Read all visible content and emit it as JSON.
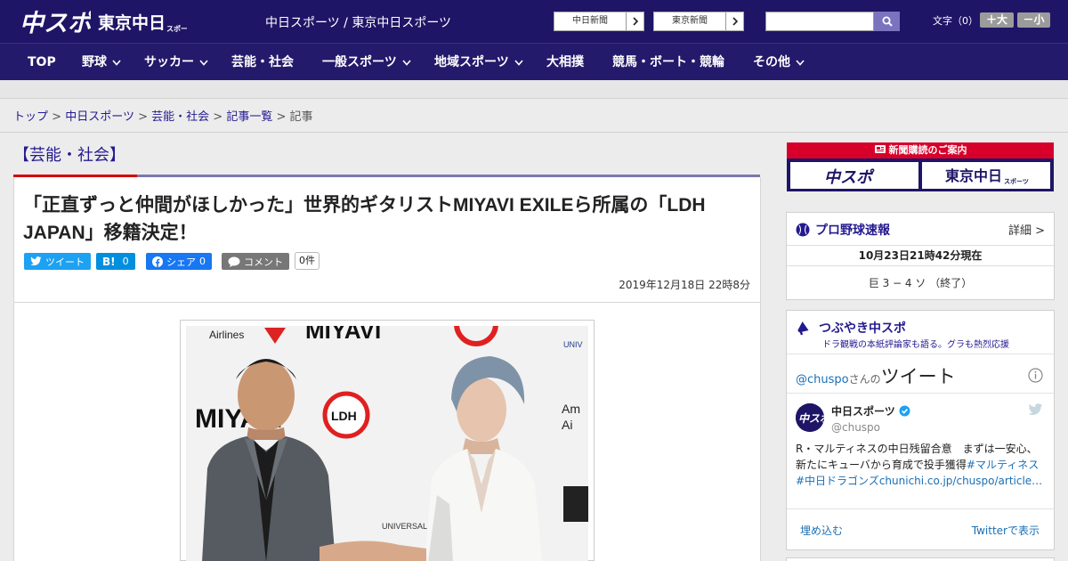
{
  "header": {
    "logo_main": "中スポ",
    "logo_tokyo": "東京中日",
    "logo_tokyo_sub": "スポーツ",
    "site_title": "中日スポーツ / 東京中日スポーツ",
    "paper_links": [
      {
        "label": "中日新聞"
      },
      {
        "label": "東京新聞"
      }
    ],
    "search": {
      "placeholder": "",
      "value": ""
    },
    "font_size": {
      "label": "文字（0）",
      "increase": "＋大",
      "decrease": "－小"
    }
  },
  "nav": [
    {
      "label": "TOP",
      "dropdown": false
    },
    {
      "label": "野球",
      "dropdown": true
    },
    {
      "label": "サッカー",
      "dropdown": true
    },
    {
      "label": "芸能・社会",
      "dropdown": false
    },
    {
      "label": "一般スポーツ",
      "dropdown": true
    },
    {
      "label": "地域スポーツ",
      "dropdown": true
    },
    {
      "label": "大相撲",
      "dropdown": false
    },
    {
      "label": "競馬・ボート・競輪",
      "dropdown": false
    },
    {
      "label": "その他",
      "dropdown": true
    }
  ],
  "breadcrumb": {
    "items": [
      "トップ",
      "中日スポーツ",
      "芸能・社会",
      "記事一覧"
    ],
    "separator": ">",
    "current": "記事"
  },
  "article": {
    "section": "【芸能・社会】",
    "title": "「正直ずっと仲間がほしかった」世界的ギタリストMIYAVI EXILEら所属の「LDH JAPAN」移籍決定！",
    "share": {
      "tweet": "ツイート",
      "hatena": "B!",
      "hatena_count": "0",
      "facebook": "シェア",
      "facebook_count": "0",
      "comment": "コメント",
      "comment_count": "0件"
    },
    "date": "2019年12月18日 22時8分",
    "photo": {
      "backdrop_words": [
        "Airlines",
        "MIYAVI",
        "LDH",
        "UNIVERSAL MUSIC",
        "American Airlines"
      ]
    }
  },
  "sidebar": {
    "subscription": {
      "banner": "新聞購読のご案内",
      "logo1": "中スポ",
      "logo2": "東京中日",
      "logo2_sub": "スポーツ"
    },
    "baseball": {
      "title": "プロ野球速報",
      "detail": "詳細 >",
      "updated": "10月23日21時42分現在",
      "score": "巨 3 − 4 ソ （終了）"
    },
    "tweets": {
      "title": "つぶやき中スポ",
      "subtitle": "ドラ観戦の本紙評論家も語る。グラも熱烈応援",
      "handle": "@chuspo",
      "handle_suffix": "さんの",
      "tweet_word": "ツイート",
      "account_name": "中日スポーツ",
      "screen_name": "@chuspo",
      "body_line1": "R・マルティネスの中日残留合意　まずは一安心、",
      "body_line2_text": "新たにキューバから育成で投手獲得",
      "body_line2_tag": "#マルティネス",
      "body_line3_tag": "#中日ドラゴンズ",
      "body_line3_link": "chunichi.co.jp/chuspo/article…",
      "embed": "埋め込む",
      "view_on_twitter": "Twitterで表示"
    }
  },
  "colors": {
    "header_bg": "#1f1567",
    "nav_bg": "#241a6b",
    "accent_red": "#d00000",
    "link_blue": "#241a8f",
    "twitter_blue": "#1da1f2",
    "hatena_blue": "#008fde",
    "facebook_blue": "#1877f2",
    "comment_gray": "#777777"
  }
}
